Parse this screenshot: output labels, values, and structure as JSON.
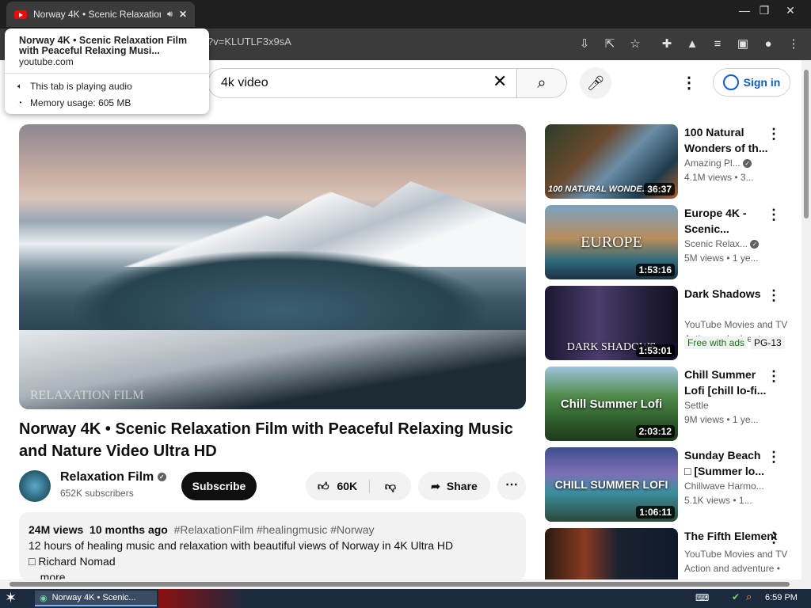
{
  "browser": {
    "tab_title": "Norway 4K • Scenic Relaxation",
    "url_visible": "?v=KLUTLF3x9sA",
    "window_controls": [
      "minimize",
      "restore",
      "close"
    ]
  },
  "hover_card": {
    "title": "Norway 4K • Scenic Relaxation Film with Peaceful Relaxing Musi...",
    "domain": "youtube.com",
    "audio": "This tab is playing audio",
    "memory": "Memory usage: 605 MB"
  },
  "header": {
    "search_value": "4k video",
    "signin_label": "Sign in"
  },
  "video": {
    "title": "Norway 4K • Scenic Relaxation Film with Peaceful Relaxing Music and Nature Video Ultra HD",
    "watermark": "RELAXATION FILM",
    "channel": "Relaxation Film",
    "subscribers": "652K subscribers",
    "subscribe_label": "Subscribe",
    "likes": "60K",
    "share_label": "Share",
    "description": {
      "views": "24M views",
      "age": "10 months ago",
      "tags": "#RelaxationFilm #healingmusic #Norway",
      "line1": "12 hours of healing music and relaxation with beautiful views of Norway in 4K Ultra HD",
      "line2": "□ Richard Nomad",
      "more": "...more"
    }
  },
  "recommendations": [
    {
      "title": "100 Natural Wonders of th...",
      "channel": "Amazing Pl...",
      "verified": true,
      "views": "4.1M views",
      "age": "• 3...",
      "duration": "36:37",
      "thumb_text": "100 NATURAL WONDE..."
    },
    {
      "title": "Europe 4K - Scenic...",
      "channel": "Scenic Relax...",
      "verified": true,
      "views": "5M views",
      "age": "• 1 ye...",
      "duration": "1:53:16",
      "thumb_text": "EUROPE"
    },
    {
      "title": "Dark Shadows",
      "channel": "YouTube Movies and TV",
      "verified": false,
      "views": "Action and adventure •",
      "age": "",
      "duration": "1:53:01",
      "thumb_text": "DARK SHADOWS",
      "badges": [
        "Free with ads",
        "PG-13"
      ]
    },
    {
      "title": "Chill Summer Lofi [chill lo-fi...",
      "channel": "Settle",
      "verified": false,
      "views": "9M views",
      "age": "• 1 ye...",
      "duration": "2:03:12",
      "thumb_text": "Chill Summer Lofi"
    },
    {
      "title": "Sunday Beach □ [Summer lo...",
      "channel": "Chillwave Harmo...",
      "verified": false,
      "views": "5.1K views",
      "age": "• 1...",
      "duration": "1:06:11",
      "thumb_text": "CHILL SUMMER LOFI"
    },
    {
      "title": "The Fifth Element",
      "channel": "YouTube Movies and TV",
      "verified": false,
      "views": "Action and adventure •",
      "age": "",
      "duration": "",
      "thumb_text": ""
    }
  ],
  "taskbar": {
    "item_label": "Norway 4K • Scenic...",
    "clock": "6:59 PM"
  },
  "colors": {
    "accent": "#065fd4",
    "yt_red": "#ff0000",
    "free_green": "#107516"
  }
}
